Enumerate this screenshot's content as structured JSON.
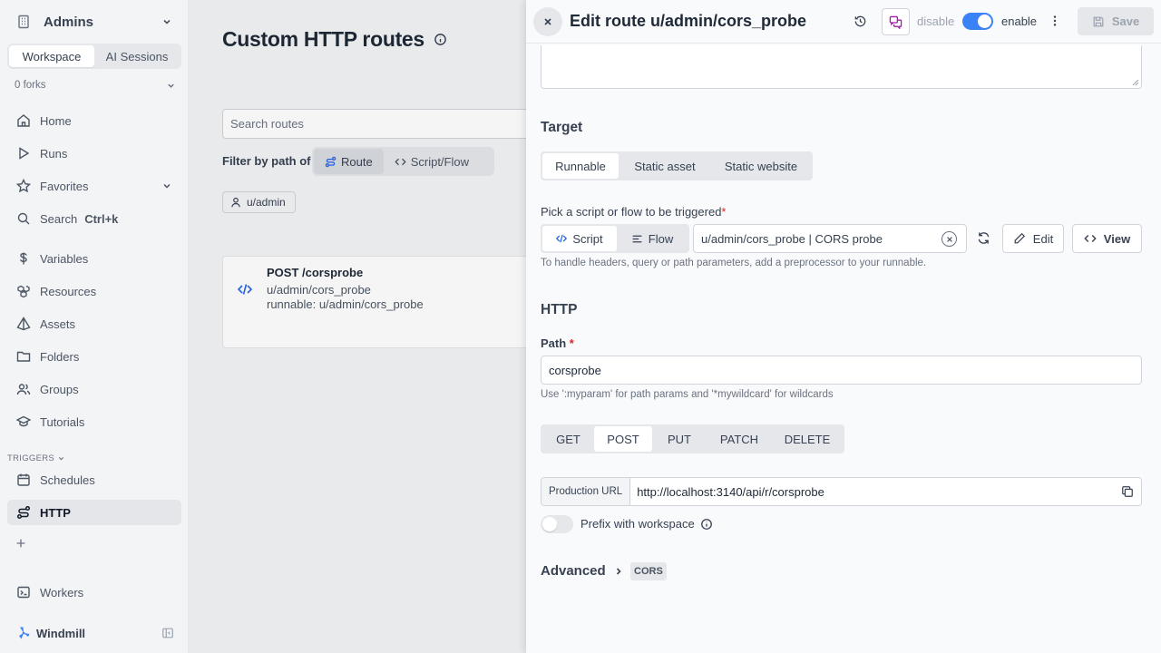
{
  "sidebar": {
    "workspace_name": "Admins",
    "tabs": [
      "Workspace",
      "AI Sessions"
    ],
    "forks": "0 forks",
    "nav": {
      "home": "Home",
      "runs": "Runs",
      "favorites": "Favorites",
      "search": "Search",
      "search_kbd": "Ctrl+k",
      "variables": "Variables",
      "resources": "Resources",
      "assets": "Assets",
      "folders": "Folders",
      "groups": "Groups",
      "tutorials": "Tutorials",
      "schedules": "Schedules",
      "http": "HTTP",
      "workers": "Workers"
    },
    "triggers_label": "TRIGGERS",
    "brand": "Windmill"
  },
  "main": {
    "title": "Custom HTTP routes",
    "search_placeholder": "Search routes",
    "filter_label": "Filter by path of",
    "filter_options": [
      "Route",
      "Script/Flow"
    ],
    "owner_chip": "u/admin",
    "route": {
      "title": "POST /corsprobe",
      "path": "u/admin/cors_probe",
      "runnable": "runnable: u/admin/cors_probe"
    }
  },
  "drawer": {
    "title": "Edit route u/admin/cors_probe",
    "disable_label": "disable",
    "enable_label": "enable",
    "save_label": "Save",
    "target": {
      "heading": "Target",
      "tabs": [
        "Runnable",
        "Static asset",
        "Static website"
      ],
      "pick_label": "Pick a script or flow to be triggered",
      "kind_tabs": [
        "Script",
        "Flow"
      ],
      "runnable_value": "u/admin/cors_probe | CORS probe",
      "edit_label": "Edit",
      "view_label": "View",
      "hint": "To handle headers, query or path parameters, add a preprocessor to your runnable."
    },
    "http": {
      "heading": "HTTP",
      "path_label": "Path",
      "path_value": "corsprobe",
      "path_hint": "Use ':myparam' for path params and '*mywildcard' for wildcards",
      "methods": [
        "GET",
        "POST",
        "PUT",
        "PATCH",
        "DELETE"
      ],
      "selected_method": "POST",
      "url_label": "Production URL",
      "url_value": "http://localhost:3140/api/r/corsprobe",
      "prefix_label": "Prefix with workspace"
    },
    "advanced": {
      "label": "Advanced",
      "badge": "CORS"
    }
  },
  "colors": {
    "accent": "#3b82f6",
    "code_blue": "#2563eb",
    "required_red": "#dc2626",
    "ai_purple": "#a21caf"
  }
}
